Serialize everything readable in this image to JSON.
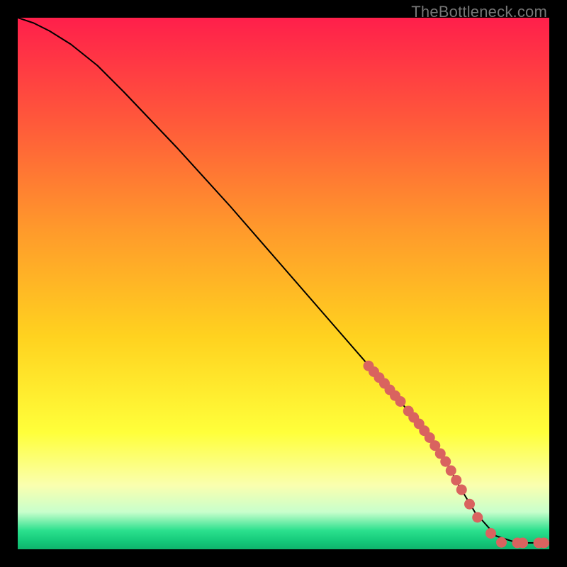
{
  "watermark": "TheBottleneck.com",
  "chart_data": {
    "type": "line",
    "title": "",
    "xlabel": "",
    "ylabel": "",
    "xlim": [
      0,
      100
    ],
    "ylim": [
      0,
      100
    ],
    "grid": false,
    "legend": false,
    "gradient_stops": [
      {
        "offset": 0.0,
        "color": "#ff1f4b"
      },
      {
        "offset": 0.2,
        "color": "#ff5a3a"
      },
      {
        "offset": 0.4,
        "color": "#ff9a2b"
      },
      {
        "offset": 0.6,
        "color": "#ffd21f"
      },
      {
        "offset": 0.78,
        "color": "#ffff3a"
      },
      {
        "offset": 0.88,
        "color": "#faffaf"
      },
      {
        "offset": 0.93,
        "color": "#c8ffcc"
      },
      {
        "offset": 0.965,
        "color": "#2be08d"
      },
      {
        "offset": 0.985,
        "color": "#14c97a"
      },
      {
        "offset": 1.0,
        "color": "#0fb46c"
      }
    ],
    "series": [
      {
        "name": "curve",
        "type": "line",
        "color": "#000000",
        "x": [
          0,
          3,
          6,
          10,
          15,
          20,
          30,
          40,
          50,
          60,
          70,
          77,
          80,
          83,
          86,
          90,
          94,
          100
        ],
        "y": [
          100,
          99,
          97.5,
          95,
          91,
          86,
          75.5,
          64.5,
          53,
          41.5,
          30,
          22,
          17.5,
          12,
          7,
          2.5,
          1.2,
          1.2
        ]
      },
      {
        "name": "dots",
        "type": "scatter",
        "color": "#d9635f",
        "x": [
          66,
          67,
          68,
          69,
          70,
          71,
          72,
          73.5,
          74.5,
          75.5,
          76.5,
          77.5,
          78.5,
          79.5,
          80.5,
          81.5,
          82.5,
          83.5,
          85,
          86.5,
          89,
          91,
          94,
          95,
          98,
          99
        ],
        "y": [
          34.5,
          33.4,
          32.3,
          31.2,
          30,
          28.9,
          27.8,
          26,
          24.8,
          23.6,
          22.3,
          21,
          19.5,
          18,
          16.5,
          14.8,
          13,
          11.2,
          8.5,
          6,
          3,
          1.3,
          1.2,
          1.2,
          1.2,
          1.2
        ]
      }
    ]
  }
}
